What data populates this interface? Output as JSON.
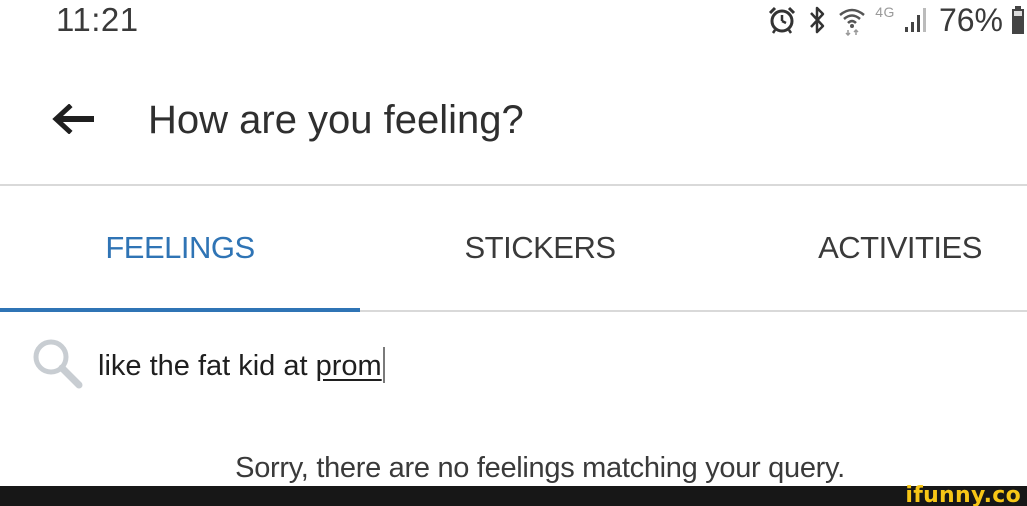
{
  "status_bar": {
    "time": "11:21",
    "network_label": "4G",
    "battery_percent": "76%",
    "icons": [
      "alarm-icon",
      "bluetooth-icon",
      "wifi-icon",
      "signal-icon",
      "battery-icon"
    ]
  },
  "header": {
    "title": "How are you feeling?",
    "back_icon": "arrow-left-icon"
  },
  "tabs": [
    {
      "label": "FEELINGS",
      "active": true
    },
    {
      "label": "STICKERS",
      "active": false
    },
    {
      "label": "ACTIVITIES",
      "active": false
    }
  ],
  "search": {
    "icon": "search-icon",
    "value_prefix": "like the fat kid at ",
    "value_underlined": "prom"
  },
  "empty_state": {
    "message": "Sorry, there are no feelings matching your query."
  },
  "watermark": {
    "text": "ifunny.co"
  },
  "colors": {
    "accent": "#2f74b5",
    "divider": "#d9d9d9",
    "watermark_bg": "#171717",
    "watermark_text": "#f7c616"
  }
}
